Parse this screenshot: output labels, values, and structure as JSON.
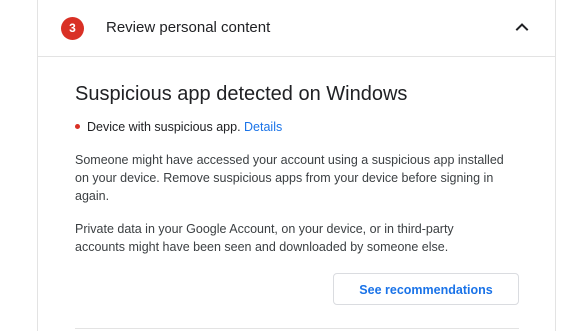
{
  "section": {
    "step_number": "3",
    "header_title": "Review personal content",
    "expanded": true,
    "badge_color": "#d93025"
  },
  "alert": {
    "title": "Suspicious app detected on Windows",
    "device_label": "Device with suspicious app.",
    "details_link": "Details",
    "paragraph1": "Someone might have accessed your account using a suspicious app installed on your device. Remove suspicious apps from your device before signing in again.",
    "paragraph2": "Private data in your Google Account, on your device, or in third-party accounts might have been seen and downloaded by someone else.",
    "button_label": "See recommendations",
    "link_color": "#1a73e8"
  },
  "icons": {
    "chevron": "chevron-up-icon",
    "bullet": "red-dot-icon"
  }
}
